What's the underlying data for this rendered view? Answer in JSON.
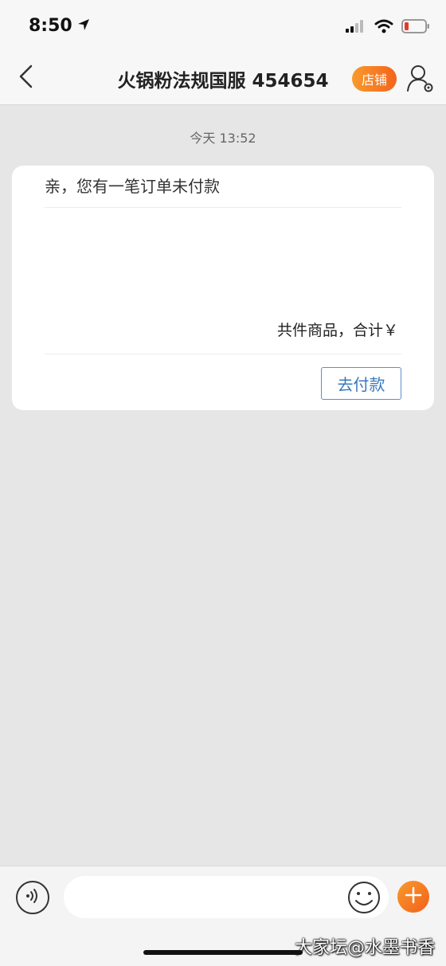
{
  "status_bar": {
    "time": "8:50",
    "icons": [
      "location-arrow-icon",
      "cellular-signal-icon",
      "wifi-icon",
      "battery-icon"
    ]
  },
  "header": {
    "title": "火锅粉法规国服 454654",
    "shop_label": "店铺",
    "icons": [
      "chevron-left-icon",
      "user-settings-icon"
    ]
  },
  "chat": {
    "timestamp": "今天 13:52",
    "order_card": {
      "title": "亲，您有一笔订单未付款",
      "total_text": "共件商品，合计￥",
      "pay_label": "去付款"
    }
  },
  "input_bar": {
    "placeholder": "",
    "icons": [
      "voice-icon",
      "emoji-icon",
      "plus-icon"
    ]
  },
  "watermark": "大家坛@水墨书香",
  "colors": {
    "accent_orange": "#f3641d",
    "link_blue": "#3a78bc",
    "background": "#e6e6e6"
  }
}
